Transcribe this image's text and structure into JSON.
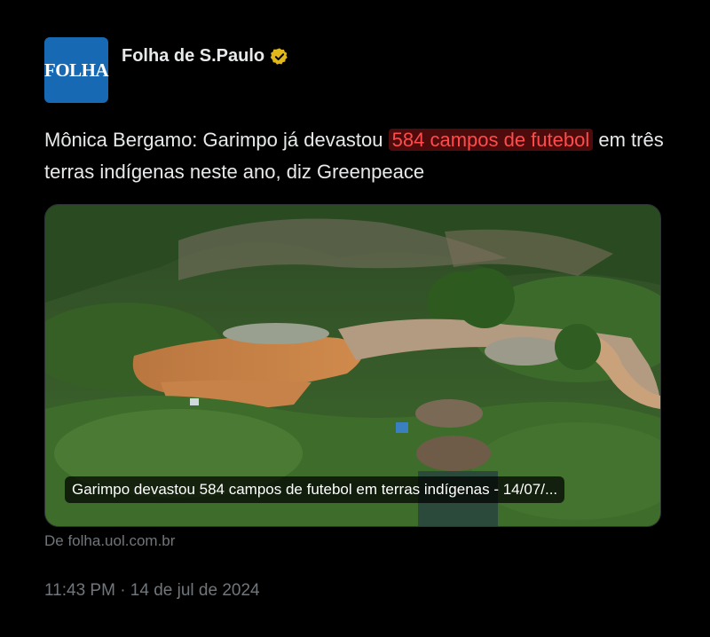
{
  "account": {
    "name": "Folha de S.Paulo",
    "avatar_text": "FOLHA",
    "avatar_color": "#1769b3",
    "verified_color": "#e2b719"
  },
  "tweet": {
    "text_before": "Mônica Bergamo: Garimpo já devastou ",
    "highlight": "584 campos de futebol",
    "text_after": " em três terras indígenas neste ano, diz Greenpeace",
    "highlight_color": "#ff4b4b"
  },
  "card": {
    "caption": "Garimpo devastou 584 campos de futebol em terras indígenas - 14/07/...",
    "image_icon": "aerial-photo-deforestation-mining"
  },
  "source": "De folha.uol.com.br",
  "timestamp": "11:43 PM · 14 de jul de 2024"
}
